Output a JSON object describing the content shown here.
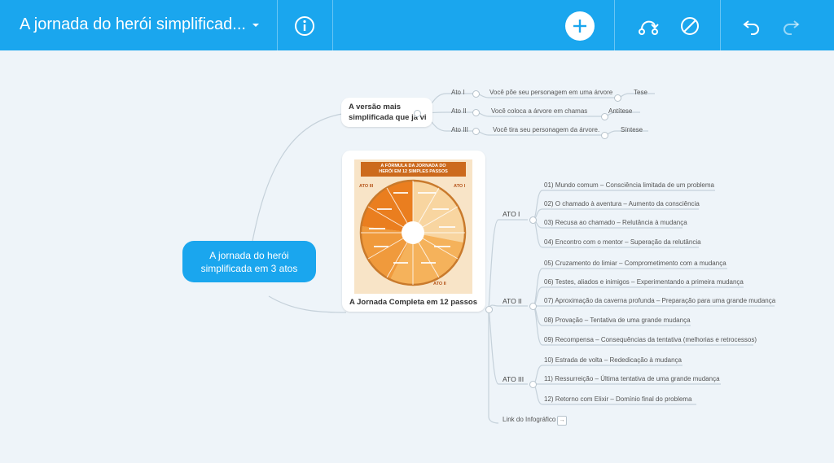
{
  "toolbar": {
    "title": "A jornada do herói simplificad...",
    "dropdown_icon": "caret-down-icon",
    "info_icon": "info-icon",
    "add_icon": "plus-icon",
    "connect_icon": "connection-icon",
    "disable_icon": "prohibited-icon",
    "undo_icon": "undo-icon",
    "redo_icon": "redo-icon",
    "bar_color": "#1aa6ee"
  },
  "map": {
    "root_line1": "A jornada do herói",
    "root_line2": "simplificada em 3 atos",
    "root_color": "#1aa6ee",
    "branch1_line1": "A versão mais",
    "branch1_line2": "simplificada que já vi",
    "branch1_children": [
      {
        "ato": "Ato I",
        "desc": "Você põe seu personagem em uma árvore",
        "label": "Tese"
      },
      {
        "ato": "Ato II",
        "desc": "Você coloca a árvore em chamas",
        "label": "Antítese"
      },
      {
        "ato": "Ato III",
        "desc": "Você tira seu personagem da árvore.",
        "label": "Síntese"
      }
    ],
    "branch2_label": "A Jornada Completa em 12 passos",
    "infographic": {
      "title_line1": "A FÓRMULA DA JORNADA DO",
      "title_line2": "HERÓI EM 12 SIMPLES PASSOS",
      "ato1": "ATO I",
      "ato2": "ATO II",
      "ato3": "ATO III"
    },
    "acts": [
      {
        "label": "ATO I",
        "steps": [
          "01) Mundo comum – Consciência limitada de um problema",
          "02) O chamado à aventura – Aumento da consciência",
          "03) Recusa ao chamado – Relutância à mudança",
          "04) Encontro com o mentor – Superação da relutância"
        ]
      },
      {
        "label": "ATO II",
        "steps": [
          "05) Cruzamento do limiar – Comprometimento com a mudança",
          "06) Testes, aliados e inimigos – Experimentando a primeira mudança",
          "07) Aproximação da caverna profunda – Preparação para uma grande mudança",
          "08) Provação – Tentativa de uma grande mudança",
          "09) Recompensa – Consequências da tentativa (melhorias e retrocessos)"
        ]
      },
      {
        "label": "ATO III",
        "steps": [
          "10) Estrada de volta – Rededicação à mudança",
          "11) Ressurreição – Última tentativa de uma grande mudança",
          "12) Retorno com Elixir – Domínio final do problema"
        ]
      }
    ],
    "link_label": "Link do Infográfico",
    "link_icon": "external-link-icon"
  }
}
